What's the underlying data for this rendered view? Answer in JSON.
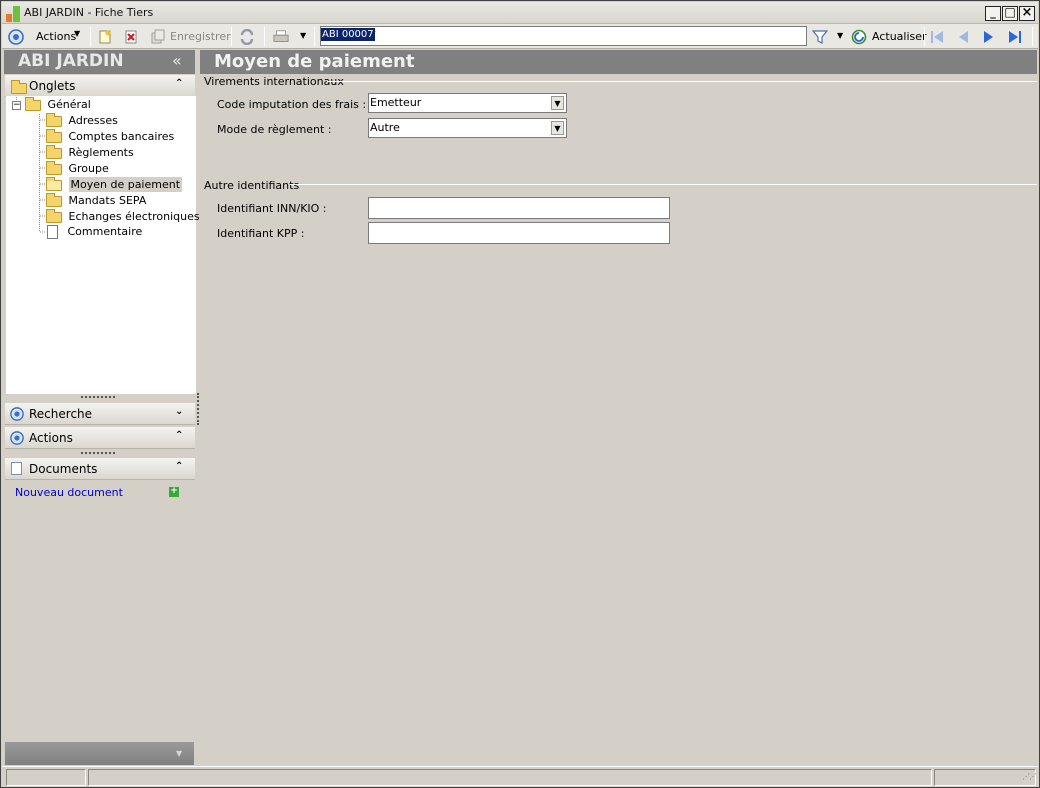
{
  "window": {
    "title": "ABI JARDIN - Fiche Tiers",
    "minimize": "_",
    "maximize": "□",
    "close": "×"
  },
  "toolbar": {
    "actions_label": "Actions",
    "save_label": "Enregistrer",
    "search_value": "ABI 00007",
    "refresh_label": "Actualiser"
  },
  "left_pane": {
    "header": "ABI JARDIN",
    "collapse_glyph": "«",
    "onglets_label": "Onglets",
    "tree": {
      "root": "Général",
      "children": [
        "Adresses",
        "Comptes bancaires",
        "Règlements",
        "Groupe",
        "Moyen de paiement",
        "Mandats SEPA",
        "Echanges électroniques",
        "Commentaire"
      ],
      "selected": "Moyen de paiement"
    },
    "recherche_label": "Recherche",
    "actions_label": "Actions",
    "documents_label": "Documents",
    "new_document_link": "Nouveau document"
  },
  "content": {
    "title": "Moyen de paiement",
    "group1": {
      "title": "Virements internationaux",
      "code_imputation_label": "Code imputation des frais :",
      "code_imputation_value": "Emetteur",
      "mode_reglement_label": "Mode de règlement :",
      "mode_reglement_value": "Autre"
    },
    "group2": {
      "title": "Autre identifiants",
      "inn_label": "Identifiant INN/KIO :",
      "inn_value": "",
      "kpp_label": "Identifiant KPP :",
      "kpp_value": ""
    }
  },
  "colors": {
    "header_gray": "#808080",
    "window_bg": "#d4d0c8",
    "link_blue": "#0000c8",
    "nav_blue": "#2a66d9"
  }
}
